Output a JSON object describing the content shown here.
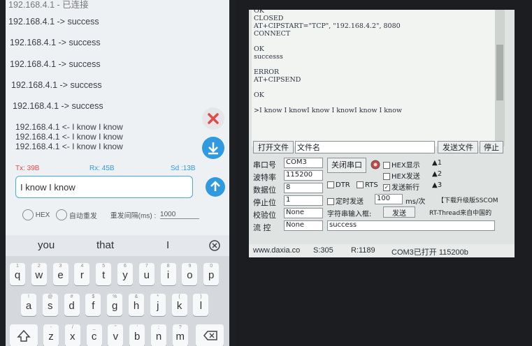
{
  "phone": {
    "log_top": "192.168.4.1 - 已连接",
    "log_lines": [
      "192.168.4.1 -> success",
      "192.168.4.1 -> success",
      "192.168.4.1 -> success",
      "192.168.4.1 -> success",
      "192.168.4.1 -> success"
    ],
    "recv_lines": [
      "192.168.4.1 <- I know I know",
      "192.168.4.1 <- I know I know",
      "192.168.4.1 <- I know I know"
    ],
    "counters": {
      "tx": "Tx: 39B",
      "rx": "Rx: 45B",
      "sd": "Sd :13B"
    },
    "input_value": "I know I know",
    "options": {
      "hex": "HEX",
      "auto_resend": "自动重发",
      "interval_label": "重发间隔(ms) :",
      "interval_value": "1000"
    },
    "suggestions": [
      "you",
      "that",
      "I"
    ],
    "keyboard": {
      "row1": [
        [
          "q",
          "1"
        ],
        [
          "w",
          "2"
        ],
        [
          "e",
          "3"
        ],
        [
          "r",
          "4"
        ],
        [
          "t",
          "5"
        ],
        [
          "y",
          "6"
        ],
        [
          "u",
          "7"
        ],
        [
          "i",
          "8"
        ],
        [
          "o",
          "9"
        ],
        [
          "p",
          "0"
        ]
      ],
      "row2": [
        [
          "a",
          "!"
        ],
        [
          "s",
          "@"
        ],
        [
          "d",
          "#"
        ],
        [
          "f",
          "$"
        ],
        [
          "g",
          "%"
        ],
        [
          "h",
          "&"
        ],
        [
          "j",
          "*"
        ],
        [
          "k",
          "("
        ],
        [
          "l",
          ")"
        ]
      ],
      "row3": [
        [
          "z",
          "-"
        ],
        [
          "x",
          "/"
        ],
        [
          "c",
          "_"
        ],
        [
          "v",
          "\""
        ],
        [
          "b",
          "'"
        ],
        [
          "n",
          ";"
        ],
        [
          "m",
          "?"
        ]
      ]
    },
    "icons": {
      "clear": "close-icon",
      "scroll": "download-arrow-icon",
      "send": "up-arrow-icon",
      "mic": "mic-icon",
      "shift": "shift-icon",
      "backspace": "backspace-icon"
    },
    "colors": {
      "accent": "#2f9ae0",
      "tx": "#e04a4a",
      "close": "#e04a4a"
    }
  },
  "terminal": {
    "lines": [
      "OK",
      "CLOSED",
      "AT+CIPSTART=\"TCP\", \"192.168.4.2\", 8080",
      "CONNECT",
      "",
      "OK",
      "successs",
      "",
      "ERROR",
      "AT+CIPSEND",
      "",
      "OK",
      "",
      ">I know I knowI know I knowI know I know"
    ]
  },
  "serial": {
    "open_file": "打开文件",
    "file_name": "文件名",
    "send_file": "发送文件",
    "stop": "停止",
    "port_label": "串口号",
    "port_value": "COM3",
    "close_port": "关闭串口",
    "hex_display": "HEX显示",
    "hex_send": "HEX发送",
    "send_newline": "发送新行",
    "baud_label": "波特率",
    "baud_value": "115200",
    "data_label": "数据位",
    "data_value": "8",
    "stop_label": "停止位",
    "stop_value": "1",
    "parity_label": "校验位",
    "parity_value": "None",
    "flow_label": "流 控",
    "flow_value": "None",
    "dtr": "DTR",
    "rts": "RTS",
    "timed_send": "定时发送",
    "period_value": "100",
    "period_unit": "ms/次",
    "string_input": "字符串输入框:",
    "send_btn": "发送",
    "send_text": "success",
    "side_1": "▲1",
    "side_2": "▲2",
    "side_3": "▲3",
    "promo_1": "【下载升级版SSCOM",
    "promo_2": "RT-Thread来自中国的",
    "status_site": "www.daxia.co",
    "status_s": "S:305",
    "status_r": "R:1189",
    "status_port": "COM3已打开  115200b"
  }
}
